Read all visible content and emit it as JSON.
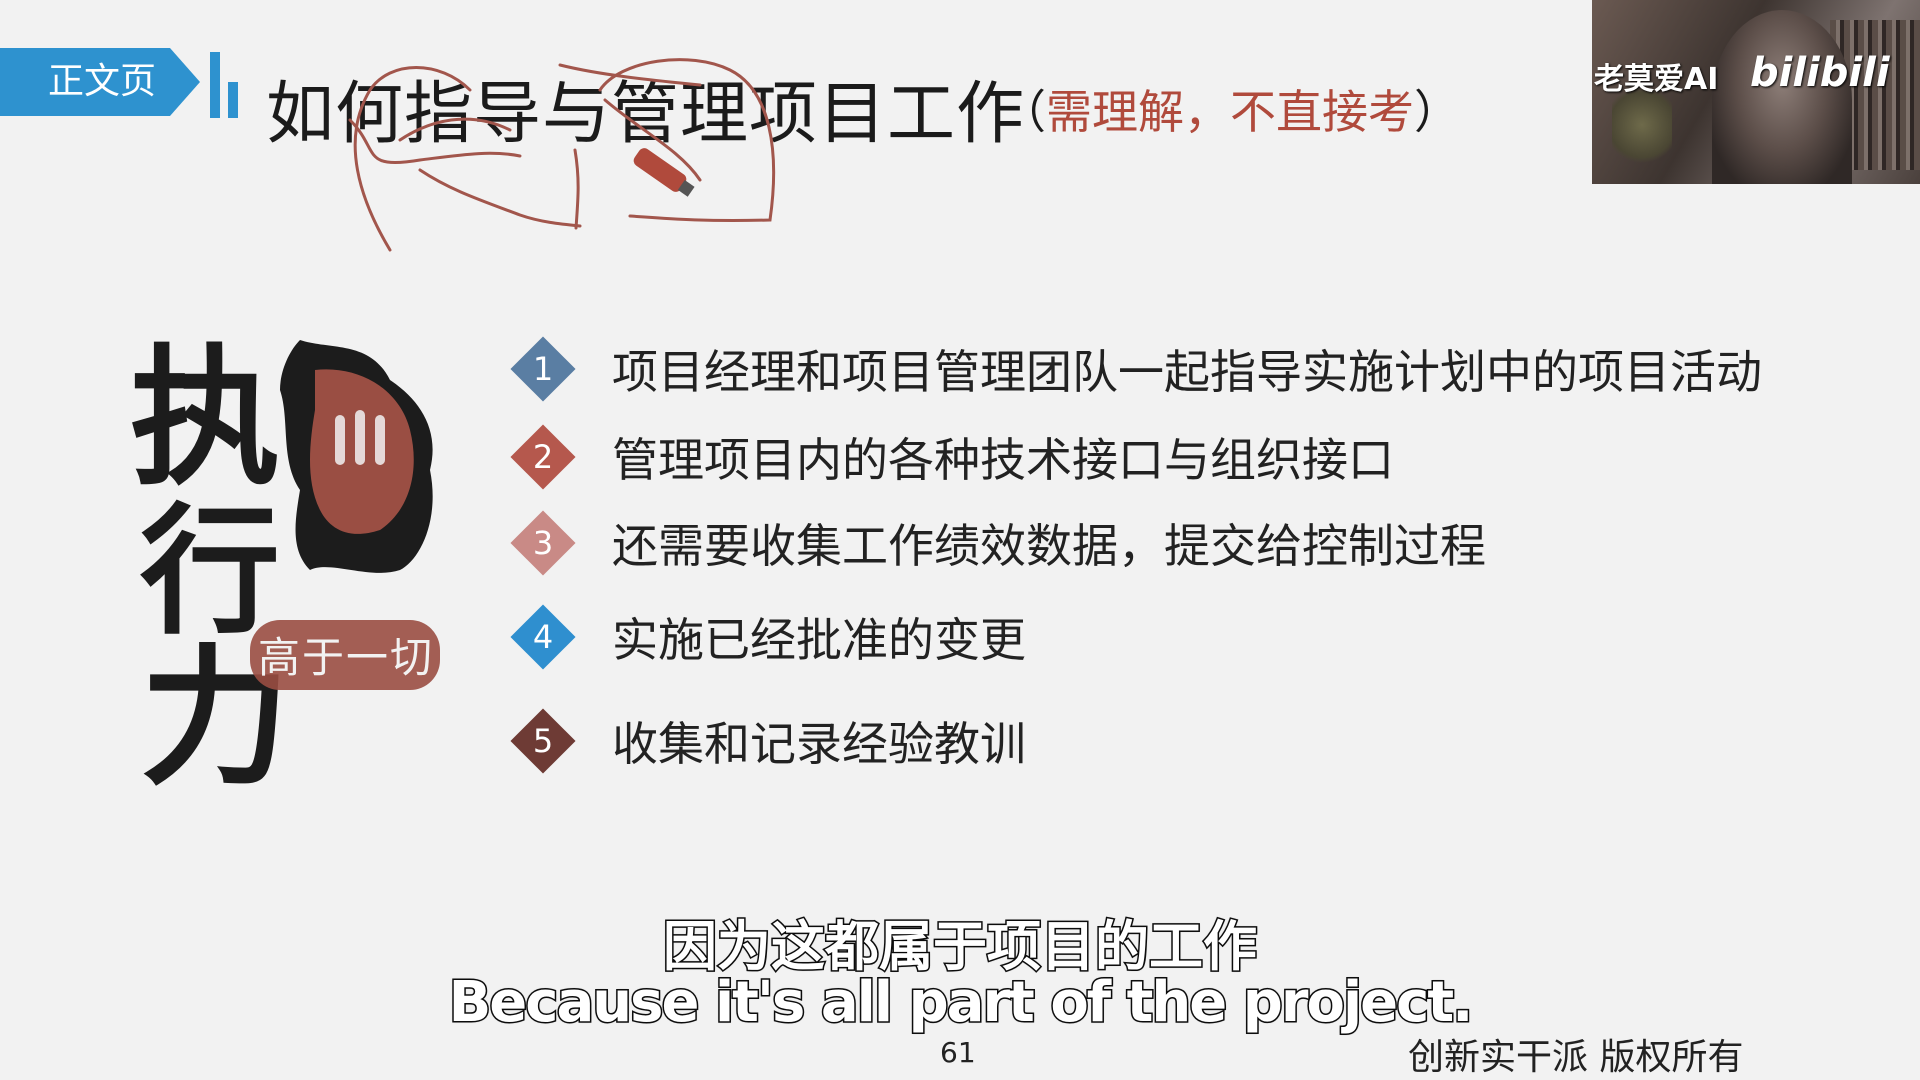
{
  "slide": {
    "tag_label": "正文页",
    "title": "如何指导与管理项目工作",
    "title_note_open": "（",
    "title_note": "需理解，不直接考",
    "title_note_close": "）",
    "page_number": "61",
    "copyright": "创新实干派  版权所有"
  },
  "video": {
    "channel_name": "老莫爱AI",
    "logo_text": "bilibili"
  },
  "art": {
    "characters": [
      "执",
      "行",
      "力"
    ],
    "stamp": [
      "高",
      "于",
      "一",
      "切"
    ]
  },
  "items": [
    {
      "num": "1",
      "text": "项目经理和项目管理团队一起指导实施计划中的项目活动",
      "color": "#5a7ea3"
    },
    {
      "num": "2",
      "text": "管理项目内的各种技术接口与组织接口",
      "color": "#b5584d"
    },
    {
      "num": "3",
      "text": "还需要收集工作绩效数据，提交给控制过程",
      "color": "#c98a86"
    },
    {
      "num": "4",
      "text": "实施已经批准的变更",
      "color": "#2f8fcf"
    },
    {
      "num": "5",
      "text": "收集和记录经验教训",
      "color": "#6e3b35"
    }
  ],
  "subtitles": {
    "zh": "因为这都属于项目的工作",
    "en": "Because it's all part of the project."
  },
  "colors": {
    "accent": "#2e92cf",
    "annotation": "#b04a3c",
    "ink": "#a2564c"
  }
}
